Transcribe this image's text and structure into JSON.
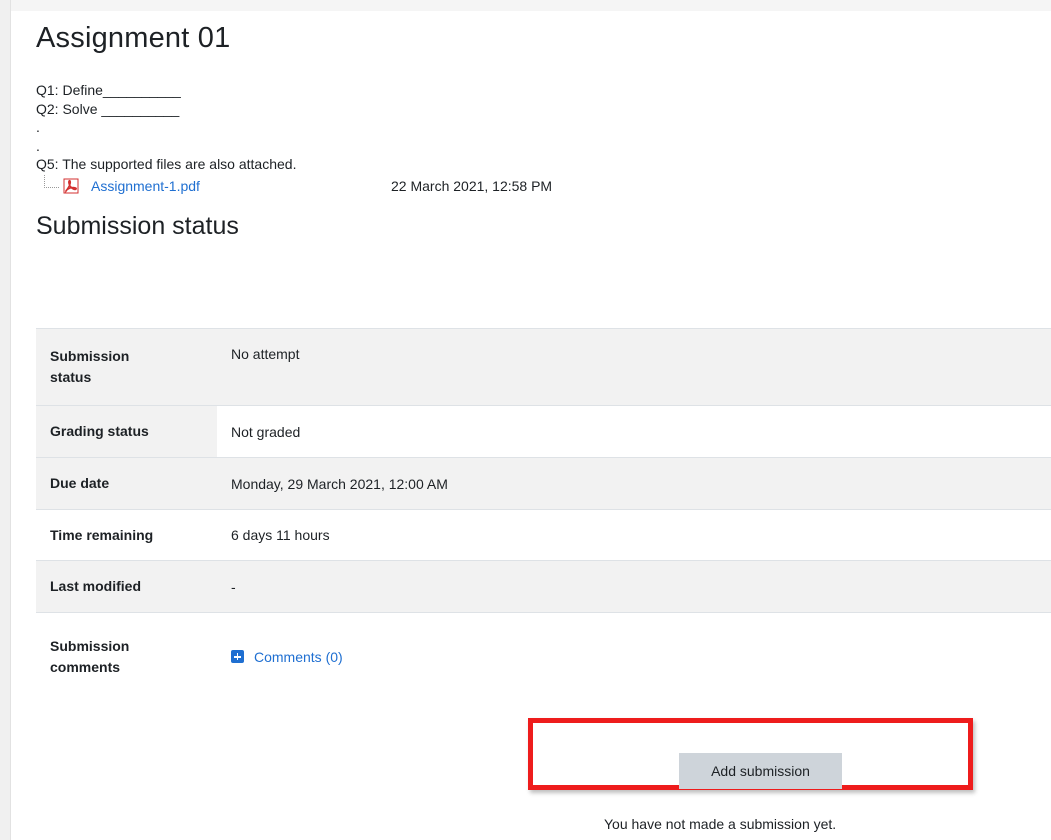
{
  "assignment": {
    "title": "Assignment 01",
    "intro_lines": [
      "Q1: Define__________",
      "Q2: Solve __________",
      ".",
      ".",
      "Q5: The supported files are also attached."
    ],
    "attachment": {
      "icon": "pdf-icon",
      "file_name": "Assignment-1.pdf",
      "date": "22 March 2021, 12:58 PM"
    }
  },
  "submission_status": {
    "title": "Submission status",
    "rows": [
      {
        "label": "Submission status",
        "value": "No attempt"
      },
      {
        "label": "Grading status",
        "value": "Not graded"
      },
      {
        "label": "Due date",
        "value": "Monday, 29 March 2021, 12:00 AM"
      },
      {
        "label": "Time remaining",
        "value": "6 days 11 hours"
      },
      {
        "label": "Last modified",
        "value": "-"
      },
      {
        "label": "Submission comments",
        "value": "Comments (0)"
      }
    ]
  },
  "actions": {
    "add_submission_label": "Add submission",
    "no_submission_message": "You have not made a submission yet."
  },
  "colors": {
    "link": "#1f6fd1",
    "highlight": "#ee1c1c",
    "button_bg": "#ced4da"
  }
}
